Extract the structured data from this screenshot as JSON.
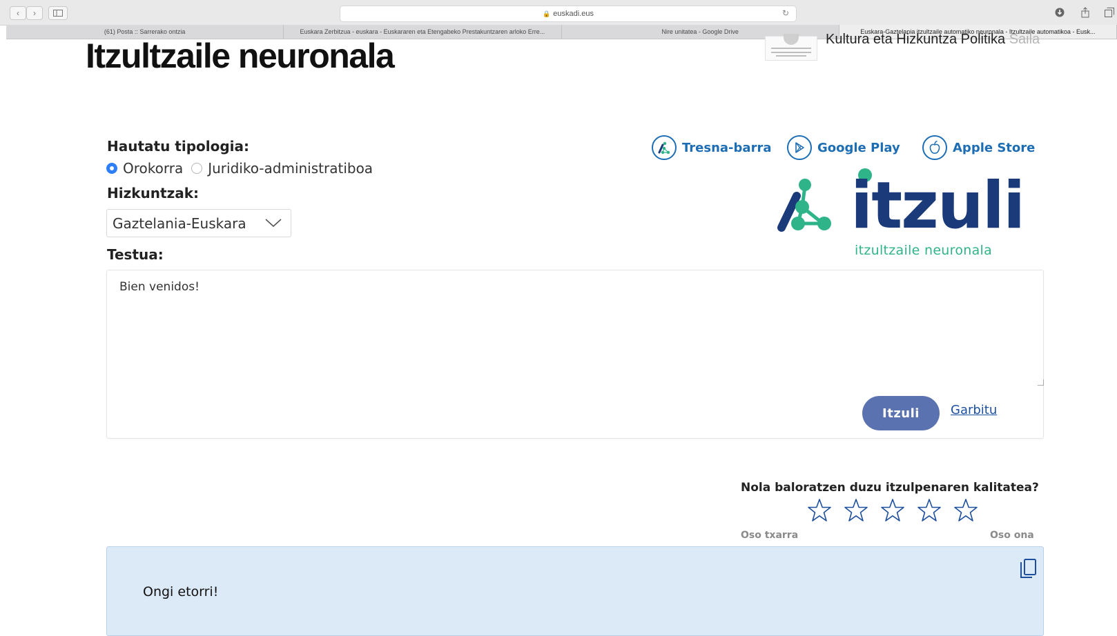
{
  "browser": {
    "url": "euskadi.eus",
    "tabs": [
      {
        "label": "(61) Posta :: Sarrerako ontzia"
      },
      {
        "label": "Euskara Zerbitzua - euskara - Euskararen eta Etengabeko Prestakuntzaren arloko Erre..."
      },
      {
        "label": "Nire unitatea - Google Drive"
      },
      {
        "label": "Euskara-Gaztelania itzultzaile automatiko neuronala - Itzultzaile automatikoa - Eusk..."
      }
    ],
    "active_tab": 3
  },
  "header": {
    "title": "Itzultzaile neuronala",
    "department": "Kultura eta Hizkuntza Politika",
    "department_suffix": "Saila"
  },
  "form": {
    "typology_label": "Hautatu tipologia:",
    "typology_options": [
      {
        "label": "Orokorra",
        "selected": true
      },
      {
        "label": "Juridiko-administratiboa",
        "selected": false
      }
    ],
    "languages_label": "Hizkuntzak:",
    "language_selected": "Gaztelania-Euskara",
    "text_label": "Testua:",
    "source_text": "Bien venidos!",
    "translate_button": "Itzuli",
    "clear_link": "Garbitu"
  },
  "links": [
    {
      "label": "Tresna-barra",
      "icon": "toolbar-icon"
    },
    {
      "label": "Google Play",
      "icon": "google-play-icon"
    },
    {
      "label": "Apple Store",
      "icon": "apple-icon"
    }
  ],
  "logo": {
    "word": "itzuli",
    "subtitle": "itzultzaile neuronala",
    "colors": {
      "navy": "#1b3a7a",
      "green": "#2fb48a"
    }
  },
  "rating": {
    "question": "Nola baloratzen duzu itzulpenaren kalitatea?",
    "stars_total": 5,
    "stars_selected": 0,
    "low_label": "Oso txarra",
    "high_label": "Oso ona"
  },
  "result": {
    "text": "Ongi etorri!"
  },
  "colors": {
    "accent_blue": "#1d6db5",
    "button": "#5b72b0",
    "result_bg": "#dce9f6"
  }
}
